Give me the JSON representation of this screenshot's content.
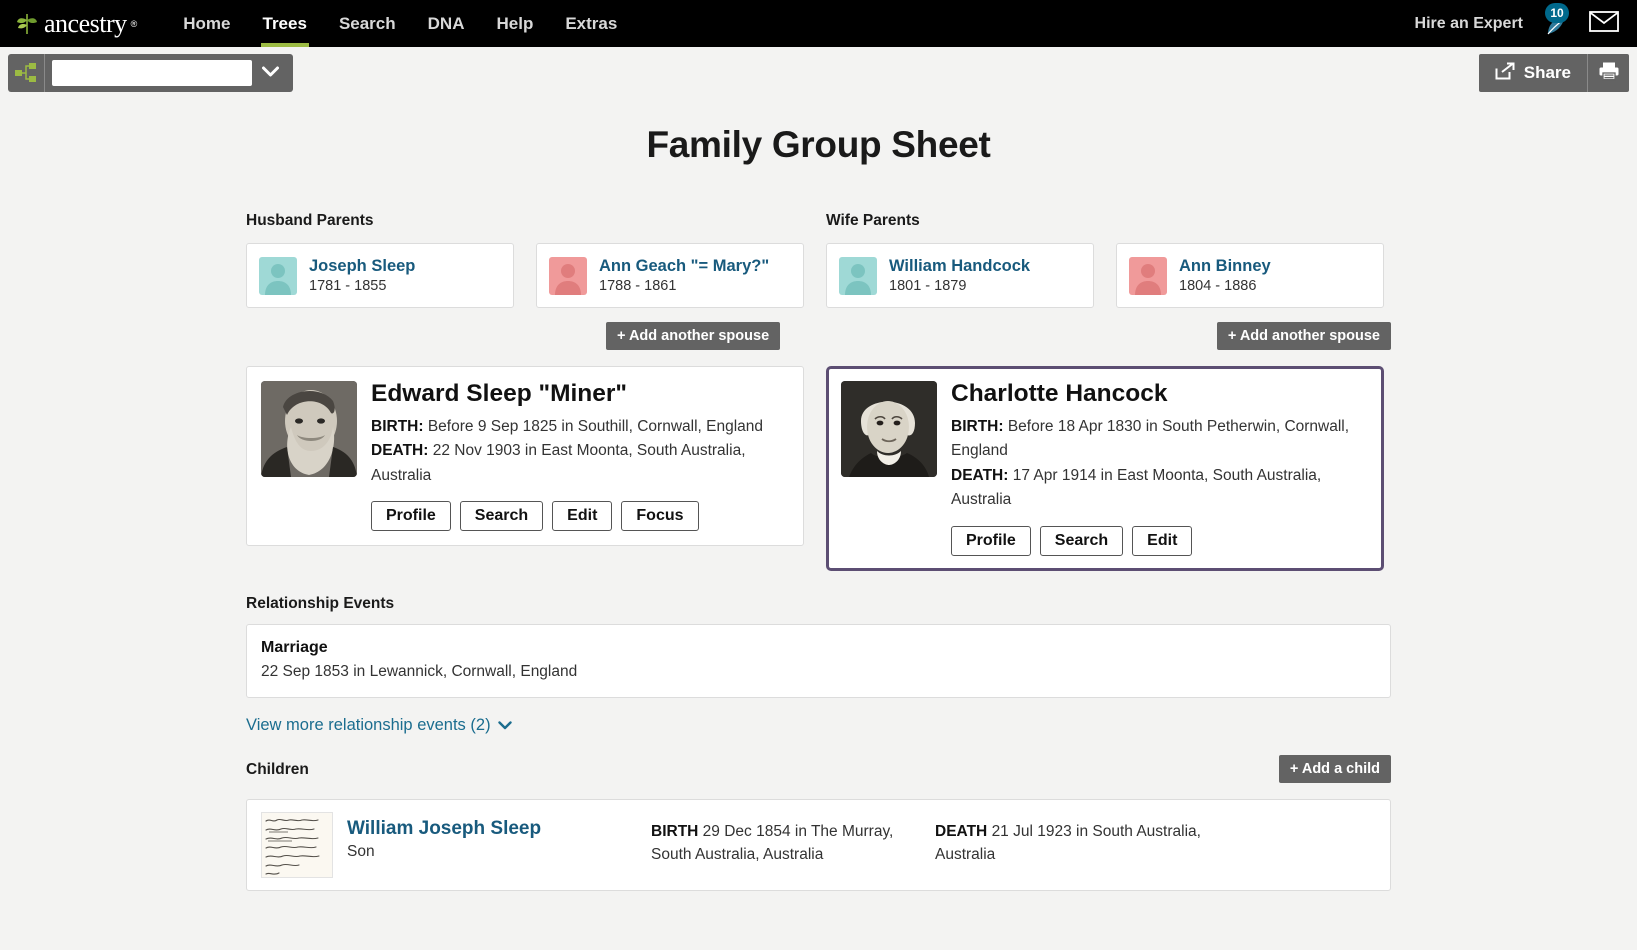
{
  "nav": {
    "brand": "ancestry",
    "trademark": "®",
    "items": [
      {
        "label": "Home",
        "active": false
      },
      {
        "label": "Trees",
        "active": true
      },
      {
        "label": "Search",
        "active": false
      },
      {
        "label": "DNA",
        "active": false
      },
      {
        "label": "Help",
        "active": false
      },
      {
        "label": "Extras",
        "active": false
      }
    ],
    "hire_expert": "Hire an Expert",
    "hints_count": "10",
    "mail_icon": "envelope-icon"
  },
  "toolbar": {
    "tree_name_value": "",
    "tree_name_placeholder": "",
    "tree_icon": "family-tree-icon",
    "dropdown_icon": "chevron-down-icon",
    "share_label": "Share",
    "share_icon": "share-icon",
    "print_icon": "printer-icon"
  },
  "page": {
    "title": "Family Group Sheet"
  },
  "husband_parents": {
    "label": "Husband Parents",
    "cards": [
      {
        "name": "Joseph Sleep",
        "dates": "1781 - 1855",
        "gender": "male"
      },
      {
        "name": "Ann Geach \"= Mary?\"",
        "dates": "1788 - 1861",
        "gender": "female"
      }
    ],
    "add_spouse_label": "+ Add another spouse"
  },
  "wife_parents": {
    "label": "Wife Parents",
    "cards": [
      {
        "name": "William Handcock",
        "dates": "1801 - 1879",
        "gender": "male"
      },
      {
        "name": "Ann Binney",
        "dates": "1804 - 1886",
        "gender": "female"
      }
    ],
    "add_spouse_label": "+ Add another spouse"
  },
  "husband": {
    "name": "Edward Sleep \"Miner\"",
    "birth_label": "BIRTH:",
    "birth_value": "Before 9 Sep 1825 in Southill, Cornwall, England",
    "death_label": "DEATH:",
    "death_value": "22 Nov 1903 in East Moonta, South Australia, Australia",
    "buttons": [
      "Profile",
      "Search",
      "Edit",
      "Focus"
    ],
    "selected": false
  },
  "wife": {
    "name": "Charlotte Hancock",
    "birth_label": "BIRTH:",
    "birth_value": "Before 18 Apr 1830 in South Petherwin, Cornwall, England",
    "death_label": "DEATH:",
    "death_value": "17 Apr 1914 in East Moonta, South Australia, Australia",
    "buttons": [
      "Profile",
      "Search",
      "Edit"
    ],
    "selected": true,
    "highlight_color": "#5c4e73"
  },
  "relationship_events": {
    "heading": "Relationship Events",
    "event_title": "Marriage",
    "event_detail": "22 Sep 1853 in Lewannick, Cornwall, England",
    "view_more_label": "View more relationship events (2)",
    "view_more_icon": "chevron-down-icon"
  },
  "children": {
    "label": "Children",
    "add_child_label": "+ Add a child",
    "rows": [
      {
        "name": "William Joseph Sleep",
        "relationship": "Son",
        "birth_label": "BIRTH",
        "birth_value": "29 Dec 1854 in The Murray, South Australia, Australia",
        "death_label": "DEATH",
        "death_value": "21 Jul 1923 in South Australia, Australia",
        "thumb_icon": "document-thumbnail"
      }
    ]
  },
  "colors": {
    "nav_bg": "#000000",
    "nav_accent": "#9cbb43",
    "page_bg": "#f3f3f2",
    "link": "#185a7d",
    "button_dark": "#636363",
    "selected_border": "#5c4e73",
    "avatar_male": "#9fd9d6",
    "avatar_female": "#f09a9a",
    "badge": "#00698c"
  }
}
